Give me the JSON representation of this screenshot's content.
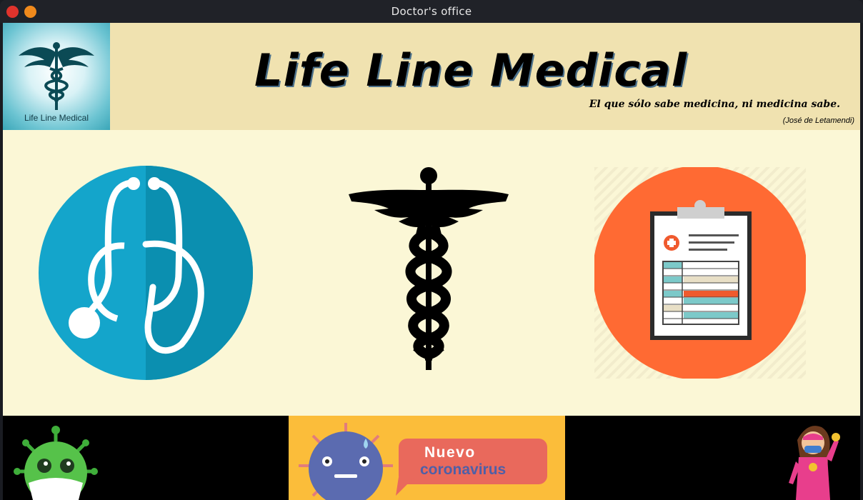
{
  "window": {
    "title": "Doctor's office"
  },
  "header": {
    "logo_caption": "Life Line Medical",
    "title": "Life Line Medical",
    "quote": "El que sólo sabe medicina, ni medicina sabe.",
    "quote_author": "(José de Letamendi)"
  },
  "main": {
    "tiles": [
      {
        "name": "stethoscope",
        "icon": "stethoscope-icon",
        "color": "#0ea5c9"
      },
      {
        "name": "caduceus",
        "icon": "caduceus-icon",
        "color": "#000000"
      },
      {
        "name": "clipboard",
        "icon": "medical-clipboard-icon",
        "color": "#ff6a33"
      }
    ]
  },
  "bottom": {
    "banner_line1": "Nuevo",
    "banner_line2": "coronavirus"
  },
  "colors": {
    "header_bg": "#f0e2b0",
    "main_bg": "#fbf7d6",
    "banner_bg": "#fbbd3a",
    "bubble": "#e9695c"
  }
}
